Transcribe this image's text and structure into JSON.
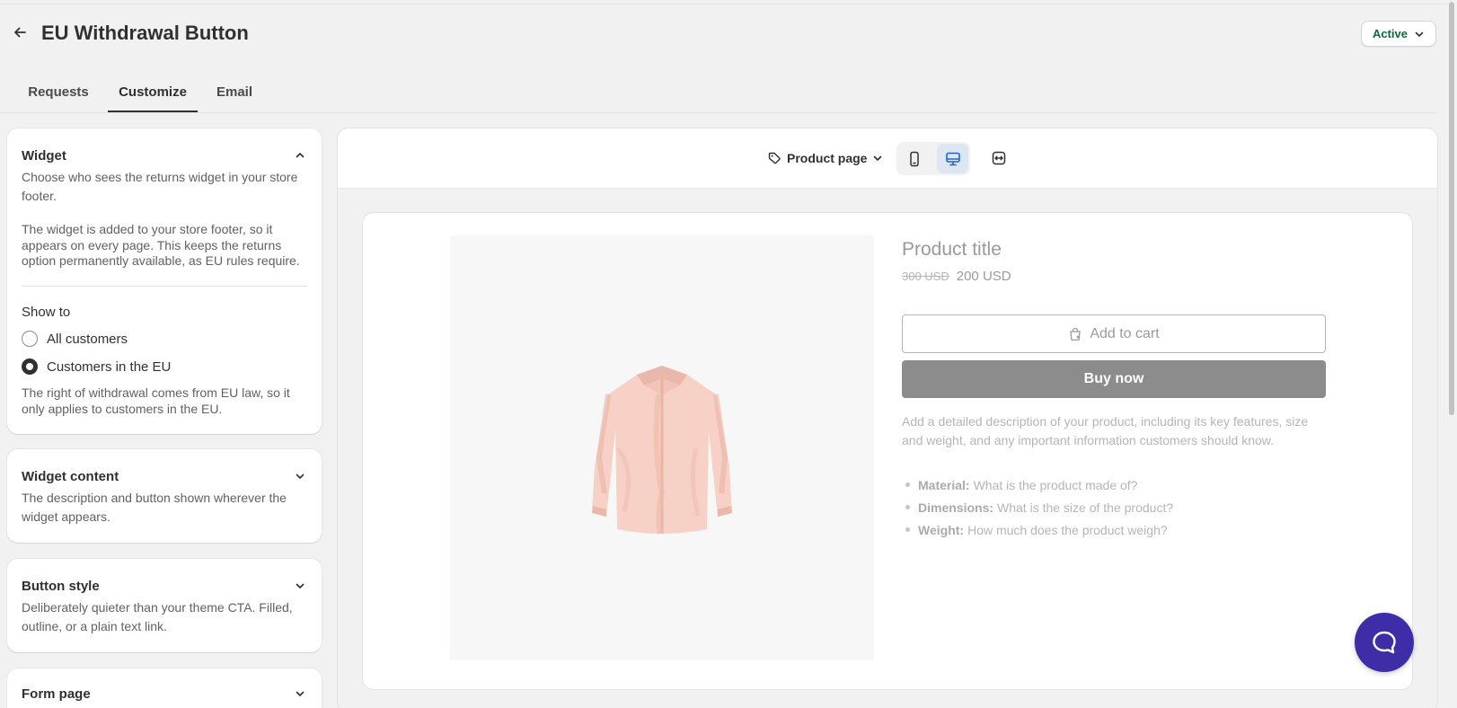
{
  "header": {
    "title": "EU Withdrawal Button",
    "status": "Active"
  },
  "tabs": [
    {
      "label": "Requests"
    },
    {
      "label": "Customize"
    },
    {
      "label": "Email"
    }
  ],
  "widget_card": {
    "title": "Widget",
    "desc": "Choose who sees the returns widget in your store footer.",
    "note": "The widget is added to your store footer, so it appears on every page. This keeps the returns option permanently available, as EU rules require.",
    "show_to_label": "Show to",
    "options": [
      {
        "label": "All customers",
        "checked": false
      },
      {
        "label": "Customers in the EU",
        "checked": true
      }
    ],
    "footnote": "The right of withdrawal comes from EU law, so it only applies to customers in the EU."
  },
  "content_card": {
    "title": "Widget content",
    "desc": "The description and button shown wherever the widget appears."
  },
  "style_card": {
    "title": "Button style",
    "desc": "Deliberately quieter than your theme CTA. Filled, outline, or a plain text link."
  },
  "form_card": {
    "title": "Form page"
  },
  "preview": {
    "page_select": "Product page",
    "icons": [
      "tag-icon",
      "mobile-icon",
      "desktop-icon",
      "fullwidth-icon"
    ],
    "product": {
      "title": "Product title",
      "compare_price": "300 USD",
      "price": "200 USD",
      "add_to_cart": "Add to cart",
      "buy_now": "Buy now",
      "description": "Add a detailed description of your product, including its key features, size and weight, and any important information customers should know.",
      "bullets": [
        {
          "label": "Material:",
          "text": "What is the product made of?"
        },
        {
          "label": "Dimensions:",
          "text": "What is the size of the product?"
        },
        {
          "label": "Weight:",
          "text": "How much does the product weigh?"
        }
      ]
    }
  },
  "colors": {
    "accent": "#3d2ea8",
    "status": "#0b6b3a",
    "buy_now": "#8c8c8c",
    "selected_device": "#dde6f3"
  }
}
